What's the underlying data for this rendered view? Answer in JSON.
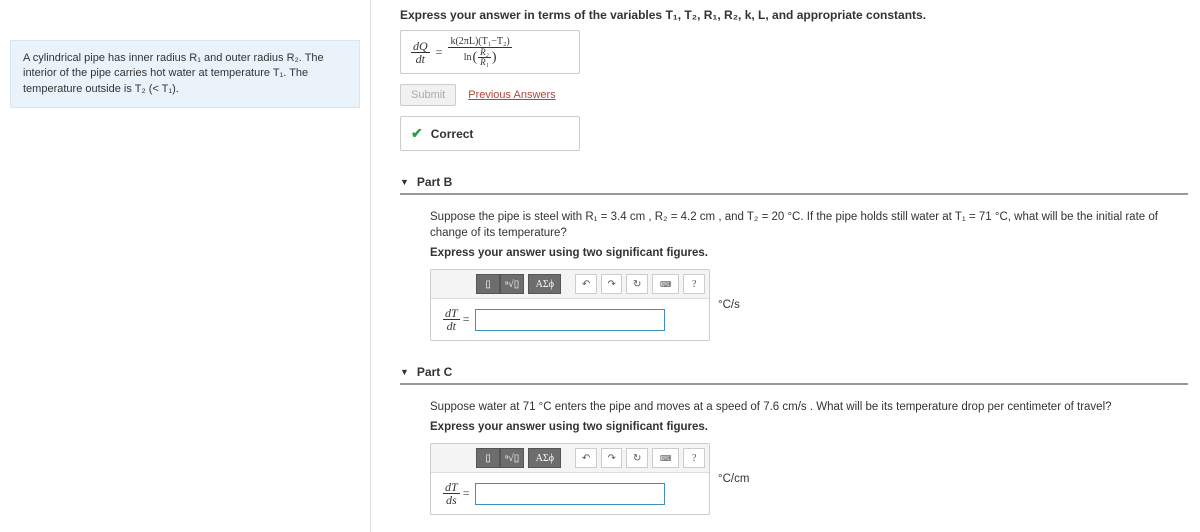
{
  "sidebar": {
    "text": "A cylindrical pipe has inner radius R₁ and outer radius R₂. The interior of the pipe carries hot water at temperature T₁. The temperature outside is T₂ (< T₁)."
  },
  "partA": {
    "instruction": "Express your answer in terms of the variables T₁, T₂, R₁, R₂, k, L, and appropriate constants.",
    "lhs_num": "dQ",
    "lhs_den": "dt",
    "eq": "=",
    "rhs_num": "k(2πL)(T₁−T₂)",
    "rhs_den_outer": "ln",
    "rhs_inner_num": "R₂",
    "rhs_inner_den": "R₁",
    "submit": "Submit",
    "prev": "Previous Answers",
    "correct": "Correct"
  },
  "partB": {
    "header": "Part B",
    "question": "Suppose the pipe is steel with R₁ = 3.4 cm , R₂ = 4.2 cm , and T₂ = 20 °C. If the pipe holds still water at T₁ = 71 °C, what will be the initial rate of change of its temperature?",
    "instruction": "Express your answer using two significant figures.",
    "lhs_num": "dT",
    "lhs_den": "dt",
    "eq": "=",
    "unit": "°C/s",
    "help": "?"
  },
  "partC": {
    "header": "Part C",
    "question": "Suppose water at 71 °C enters the pipe and moves at a speed of 7.6 cm/s . What will be its temperature drop per centimeter of travel?",
    "instruction": "Express your answer using two significant figures.",
    "lhs_num": "dT",
    "lhs_den": "ds",
    "eq": "=",
    "unit": "°C/cm",
    "help": "?"
  },
  "toolbar": {
    "templates": "▯",
    "root": "ⁿ√▯",
    "greek": "ΑΣϕ",
    "undo": "↶",
    "redo": "↷",
    "reset": "↻",
    "keyboard": "⌨"
  }
}
